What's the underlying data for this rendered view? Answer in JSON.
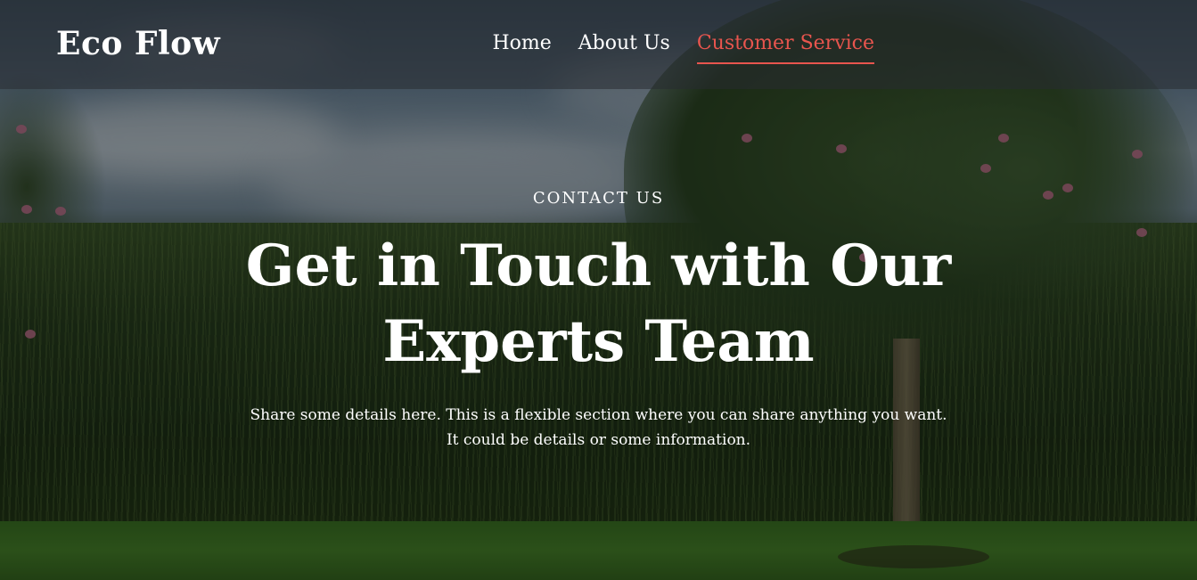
{
  "header": {
    "brand": "Eco Flow",
    "nav": [
      {
        "label": "Home",
        "active": false
      },
      {
        "label": "About Us",
        "active": false
      },
      {
        "label": "Customer Service",
        "active": true
      }
    ],
    "active_color": "#e8554e"
  },
  "hero": {
    "eyebrow": "CONTACT US",
    "headline": "Get in Touch with Our Experts Team",
    "description_line1": "Share some details here. This is a flexible section where you can share anything you want.",
    "description_line2": "It could be details or some information."
  }
}
